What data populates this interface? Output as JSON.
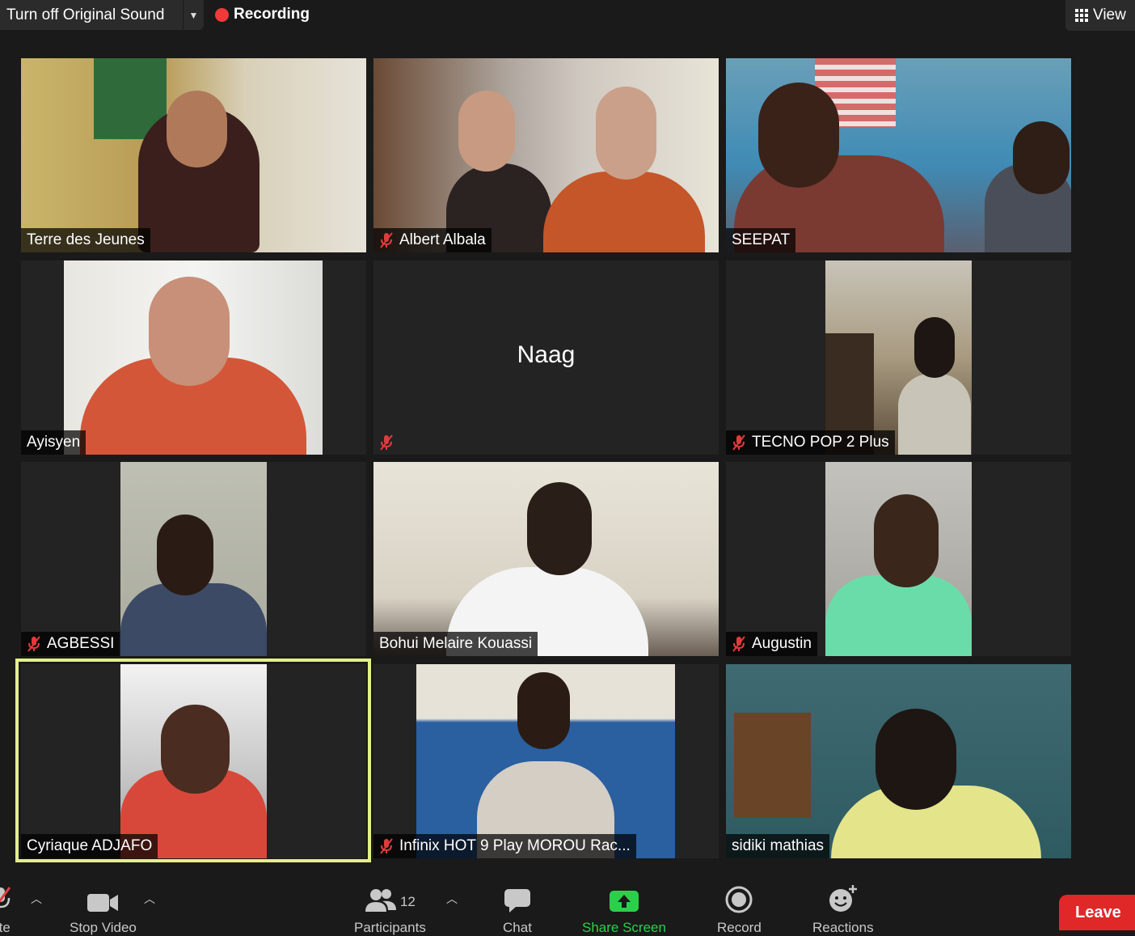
{
  "topbar": {
    "original_sound_label": "Turn off Original Sound",
    "recording_label": "Recording",
    "view_label": "View"
  },
  "gallery": {
    "tiles": [
      {
        "name": "Terre des Jeunes",
        "muted": false
      },
      {
        "name": "Albert Albala",
        "muted": true
      },
      {
        "name": "SEEPAT",
        "muted": false
      },
      {
        "name": "Ayisyen",
        "muted": false
      },
      {
        "name": "Naag",
        "muted": true
      },
      {
        "name": "TECNO POP 2 Plus",
        "muted": true
      },
      {
        "name": "AGBESSI",
        "muted": true
      },
      {
        "name": "Bohui Melaire Kouassi",
        "muted": false
      },
      {
        "name": "Augustin",
        "muted": true
      },
      {
        "name": "Cyriaque ADJAFO",
        "muted": false,
        "active_speaker": true
      },
      {
        "name": "Infinix HOT 9 Play MOROU Rac...",
        "muted": true
      },
      {
        "name": "sidiki mathias",
        "muted": false
      }
    ]
  },
  "toolbar": {
    "mute_label": "ute",
    "video_label": "Stop Video",
    "participants_label": "Participants",
    "participants_count": "12",
    "chat_label": "Chat",
    "share_label": "Share Screen",
    "record_label": "Record",
    "reactions_label": "Reactions",
    "leave_label": "Leave"
  },
  "colors": {
    "share_green": "#2bd04a",
    "recording_red": "#f03a3a",
    "leave_red": "#e02828",
    "active_speaker_border": "#e4ef8a"
  }
}
